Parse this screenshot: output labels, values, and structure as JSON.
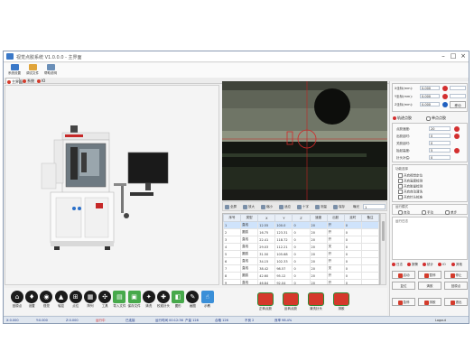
{
  "window": {
    "title": "视觉点胶系统 V1.0.0.0 - 主界面",
    "brand": "Logout"
  },
  "toolbar": [
    {
      "label": "系统设置",
      "color": "#3a78c8"
    },
    {
      "label": "调试文件",
      "color": "#e0a43a"
    },
    {
      "label": "帮助说明",
      "color": "#6a8fb8"
    }
  ],
  "tabs": [
    {
      "label": "主界面"
    },
    {
      "label": "系统"
    },
    {
      "label": "IO"
    }
  ],
  "camera_toolbar": {
    "items": [
      "全屏",
      "放大",
      "缩小",
      "适应",
      "十字",
      "测量",
      "保存"
    ],
    "field_label": "曝光",
    "field_value": "1"
  },
  "table": {
    "columns": [
      "序号",
      "类型",
      "X",
      "Y",
      "Z",
      "速度",
      "出胶",
      "延时",
      "备注"
    ],
    "rows": [
      [
        "1",
        "直线",
        "12.55",
        "100.0",
        "0",
        "20",
        "开",
        "0",
        ""
      ],
      [
        "2",
        "圆弧",
        "16.75",
        "123.31",
        "0",
        "20",
        "开",
        "0",
        ""
      ],
      [
        "3",
        "直线",
        "22.41",
        "118.72",
        "0",
        "20",
        "开",
        "0",
        ""
      ],
      [
        "4",
        "直线",
        "29.03",
        "112.21",
        "0",
        "20",
        "关",
        "0",
        ""
      ],
      [
        "5",
        "圆弧",
        "31.50",
        "105.68",
        "0",
        "20",
        "开",
        "0",
        ""
      ],
      [
        "6",
        "直线",
        "34.15",
        "102.33",
        "0",
        "20",
        "开",
        "0",
        ""
      ],
      [
        "7",
        "直线",
        "38.42",
        "98.57",
        "0",
        "20",
        "关",
        "0",
        ""
      ],
      [
        "8",
        "圆弧",
        "42.60",
        "95.12",
        "0",
        "20",
        "开",
        "0",
        ""
      ],
      [
        "9",
        "直线",
        "46.84",
        "92.04",
        "0",
        "20",
        "开",
        "0",
        ""
      ],
      [
        "10",
        "直线",
        "51.27",
        "90.63",
        "0",
        "20",
        "关",
        "0",
        ""
      ]
    ]
  },
  "right_panel": {
    "top_fields": [
      {
        "label": "X坐标(mm):",
        "value": "0.000"
      },
      {
        "label": "Y坐标(mm):",
        "value": "0.000"
      },
      {
        "label": "Z坐标(mm):",
        "value": "0.000"
      }
    ],
    "top_button": "移动",
    "radio_a": "轨迹点胶",
    "radio_b": "单点点胶",
    "params": [
      {
        "label": "点胶速度:",
        "value": "20"
      },
      {
        "label": "出胶延时:",
        "value": "0"
      },
      {
        "label": "关胶延时:",
        "value": "0"
      },
      {
        "label": "抬起高度:",
        "value": "5"
      },
      {
        "label": "针头补偿:",
        "value": "0"
      }
    ],
    "options_title": "功能选择",
    "checks": [
      "开启视觉定位",
      "开启高度检测",
      "开启胶量检测",
      "开启自动清洗",
      "开启针头校准"
    ],
    "mode_title": "运行模式",
    "modes": [
      "自动",
      "手动",
      "单步"
    ],
    "log_title": "运行日志",
    "tabs": [
      "日志",
      "报警",
      "统计",
      "IO",
      "其他"
    ],
    "action_row1": [
      "启动",
      "暂停",
      "停止"
    ],
    "action_row2": [
      "复位",
      "清胶",
      "回原点"
    ],
    "action_row3": [
      "急停",
      "排胶",
      "退出"
    ]
  },
  "bottom_buttons": [
    {
      "label": "回原点",
      "kind": "circle",
      "glyph": "⌂"
    },
    {
      "label": "设置",
      "kind": "circle",
      "glyph": "♦"
    },
    {
      "label": "视觉",
      "kind": "circle",
      "glyph": "◉"
    },
    {
      "label": "轴控",
      "kind": "circle",
      "glyph": "▲"
    },
    {
      "label": "点位",
      "kind": "circle",
      "glyph": "⊞"
    },
    {
      "label": "阵列",
      "kind": "circle",
      "glyph": "▦"
    },
    {
      "label": "工具",
      "kind": "circle",
      "glyph": "✣"
    },
    {
      "label": "导入文件",
      "kind": "square",
      "glyph": "▤"
    },
    {
      "label": "保存文件",
      "kind": "square",
      "glyph": "▣"
    },
    {
      "label": "清洗",
      "kind": "circle",
      "glyph": "✦"
    },
    {
      "label": "校准针头",
      "kind": "circle",
      "glyph": "✚"
    },
    {
      "label": "图形",
      "kind": "square",
      "glyph": "◧"
    },
    {
      "label": "画图",
      "kind": "circle",
      "glyph": "✎"
    },
    {
      "label": "示教",
      "kind": "teach",
      "glyph": "☝"
    }
  ],
  "red_buttons": [
    {
      "label": "正转点胶"
    },
    {
      "label": "反转点胶"
    },
    {
      "label": "清洗针头"
    },
    {
      "label": "排胶"
    }
  ],
  "status": [
    {
      "text": "X:0.000",
      "color": "#1f3a8a"
    },
    {
      "text": "Y:0.000",
      "color": "#1f3a8a"
    },
    {
      "text": "Z:0.000",
      "color": "#1f3a8a"
    },
    {
      "text": "运行中",
      "color": "#d32f2f"
    },
    {
      "text": "已连接",
      "color": "#1f3a8a"
    },
    {
      "text": "运行时间 00:12:36",
      "color": "#1f3a8a"
    },
    {
      "text": "产量 128",
      "color": "#1f3a8a"
    },
    {
      "text": "合格 126",
      "color": "#1f3a8a"
    },
    {
      "text": "不良 2",
      "color": "#1f3a8a"
    },
    {
      "text": "良率 98.4%",
      "color": "#1f3a8a"
    }
  ]
}
